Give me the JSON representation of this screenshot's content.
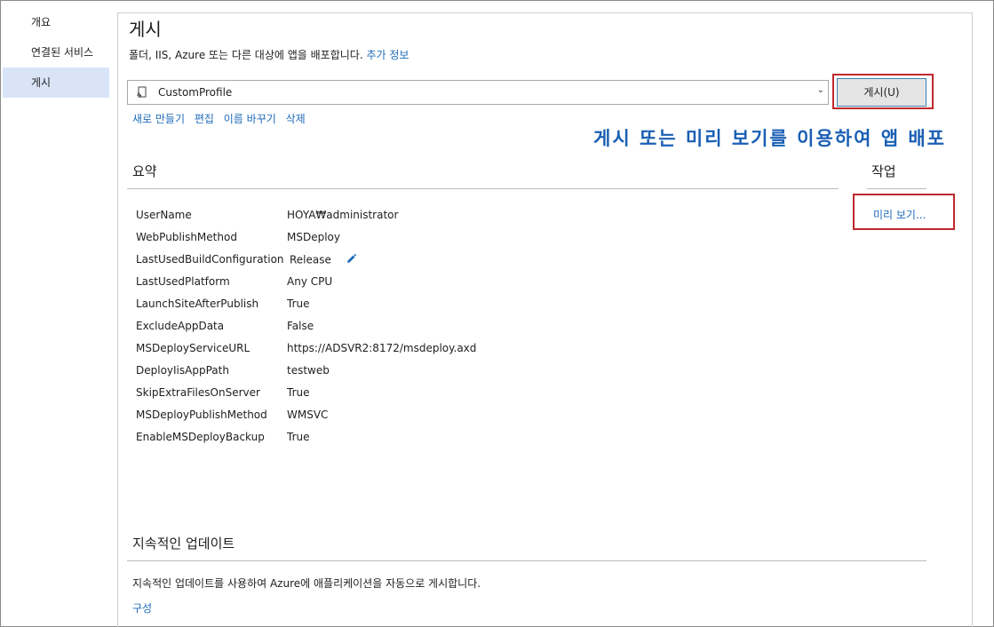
{
  "sidebar": {
    "items": [
      {
        "label": "개요"
      },
      {
        "label": "연결된 서비스"
      },
      {
        "label": "게시"
      }
    ]
  },
  "main": {
    "title": "게시",
    "description": "폴더, IIS, Azure 또는 다른 대상에 앱을 배포합니다.",
    "more_info_link": "추가 정보",
    "profile": {
      "selected": "CustomProfile"
    },
    "publish_button": "게시(U)",
    "profile_actions": {
      "new": "새로 만들기",
      "edit": "편집",
      "rename": "이름 바꾸기",
      "delete": "삭제"
    },
    "annotation": "게시 또는 미리 보기를 이용하여 앱 배포"
  },
  "summary": {
    "title": "요약",
    "rows": [
      {
        "key": "UserName",
        "value": "HOYA₩administrator"
      },
      {
        "key": "WebPublishMethod",
        "value": "MSDeploy"
      },
      {
        "key": "LastUsedBuildConfiguration",
        "value": "Release"
      },
      {
        "key": "LastUsedPlatform",
        "value": "Any CPU"
      },
      {
        "key": "LaunchSiteAfterPublish",
        "value": "True"
      },
      {
        "key": "ExcludeAppData",
        "value": "False"
      },
      {
        "key": "MSDeployServiceURL",
        "value": "https://ADSVR2:8172/msdeploy.axd"
      },
      {
        "key": "DeployIisAppPath",
        "value": "testweb"
      },
      {
        "key": "SkipExtraFilesOnServer",
        "value": "True"
      },
      {
        "key": "MSDeployPublishMethod",
        "value": "WMSVC"
      },
      {
        "key": "EnableMSDeployBackup",
        "value": "True"
      }
    ]
  },
  "actions": {
    "title": "작업",
    "preview_link": "미리 보기..."
  },
  "continuous_update": {
    "title": "지속적인 업데이트",
    "description": "지속적인 업데이트를 사용하여 Azure에 애플리케이션을 자동으로 게시합니다.",
    "configure_link": "구성"
  },
  "colors": {
    "link": "#1e6bb8",
    "highlight_box": "#c0282e",
    "annotation": "#1a5fb4"
  }
}
